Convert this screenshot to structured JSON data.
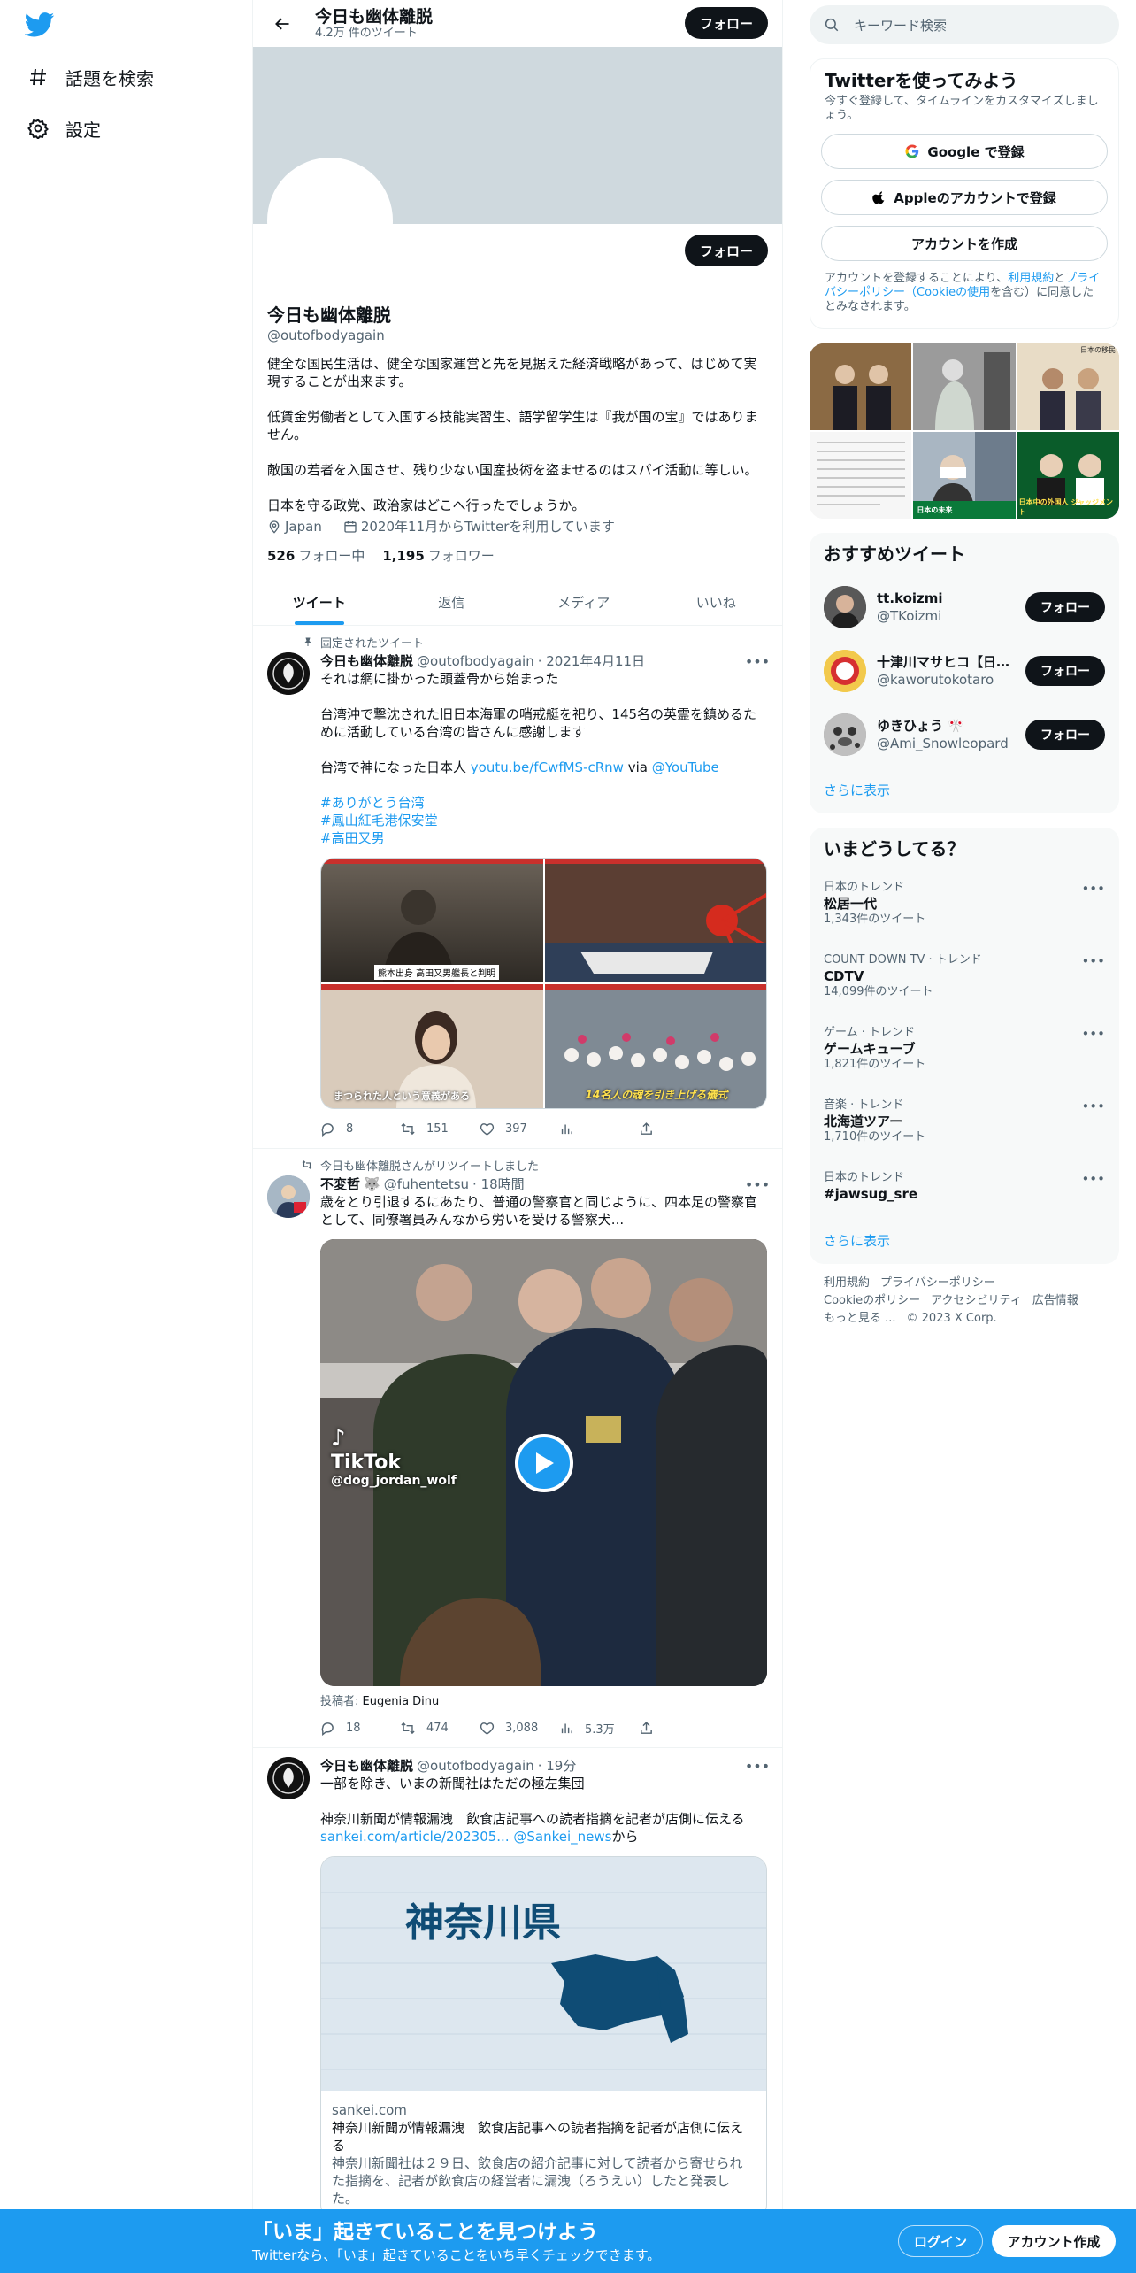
{
  "nav": {
    "logo": "twitter-bird",
    "items": [
      {
        "label": "話題を検索",
        "icon": "hashtag-icon"
      },
      {
        "label": "設定",
        "icon": "gear-icon"
      }
    ]
  },
  "header": {
    "title": "今日も幽体離脱",
    "subtitle": "4.2万 件のツイート",
    "follow_label": "フォロー"
  },
  "profile": {
    "name": "今日も幽体離脱",
    "handle": "@outofbodyagain",
    "follow_label": "フォロー",
    "bio": [
      "健全な国民生活は、健全な国家運営と先を見据えた経済戦略があって、はじめて実現することが出来ます。",
      "低賃金労働者として入国する技能実習生、語学留学生は『我が国の宝』ではありません。",
      "敵国の若者を入国させ、残り少ない国産技術を盗ませるのはスパイ活動に等しい。",
      "日本を守る政党、政治家はどこへ行ったでしょうか。"
    ],
    "location": "Japan",
    "joined": "2020年11月からTwitterを利用しています",
    "following_count": "526",
    "following_label": "フォロー中",
    "followers_count": "1,195",
    "followers_label": "フォロワー"
  },
  "tabs": [
    "ツイート",
    "返信",
    "メディア",
    "いいね"
  ],
  "tweets": [
    {
      "context": "固定されたツイート",
      "name": "今日も幽体離脱",
      "handle": "@outofbodyagain",
      "time": "· 2021年4月11日",
      "line1": "それは網に掛かった頭蓋骨から始まった",
      "line2": "台湾沖で撃沈された旧日本海軍の哨戒艇を祀り、145名の英霊を鎮めるために活動している台湾の皆さんに感謝します",
      "line3_prefix": "台湾で神になった日本人 ",
      "link": "youtu.be/fCwfMS-cRnw",
      "via": " via ",
      "mention": "@YouTube",
      "hashtags": [
        "#ありがとう台湾",
        "#鳳山紅毛港保安堂",
        "#高田又男"
      ],
      "media_captions": [
        "熊本出身 高田又男艦長と判明",
        "まつられた人という意義がある",
        "14名人の魂を引き上げる儀式"
      ],
      "replies": "8",
      "retweets": "151",
      "likes": "397"
    },
    {
      "context": "今日も幽体離脱さんがリツイートしました",
      "name": "不変哲",
      "emoji": "🐺",
      "handle": "@fuhentetsu",
      "time": "· 18時間",
      "text": "歳をとり引退するにあたり、普通の警察官と同じように、四本足の警察官として、同僚署員みんなから労いを受ける警察犬...",
      "video_brand": "TikTok",
      "video_user": "@dog_jordan_wolf",
      "poster_label": "投稿者: ",
      "poster_name": "Eugenia Dinu",
      "replies": "18",
      "retweets": "474",
      "likes": "3,088",
      "views": "5.3万"
    },
    {
      "name": "今日も幽体離脱",
      "handle": "@outofbodyagain",
      "time": "· 19分",
      "line1": "一部を除き、いまの新聞社はただの極左集団",
      "line2": "神奈川新聞が情報漏洩　飲食店記事への読者指摘を記者が店側に伝える",
      "link": "sankei.com/article/202305...",
      "mention": "@Sankei_news",
      "suffix": "から",
      "card_map_label": "神奈川県",
      "card_domain": "sankei.com",
      "card_title": "神奈川新聞が情報漏洩　飲食店記事への読者指摘を記者が店側に伝える",
      "card_desc": "神奈川新聞社は２９日、飲食店の紹介記事に対して読者から寄せられた指摘を、記者が飲食店の経営者に漏洩（ろうえい）したと発表した。"
    }
  ],
  "search": {
    "placeholder": "キーワード検索"
  },
  "signup": {
    "title": "Twitterを使ってみよう",
    "desc": "今すぐ登録して、タイムラインをカスタマイズしましょう。",
    "google": "Google で登録",
    "apple": "Appleのアカウントで登録",
    "create": "アカウントを作成",
    "terms_1": "アカウントを登録することにより、",
    "terms_link1": "利用規約",
    "terms_2": "と",
    "terms_link2": "プライバシーポリシー",
    "terms_link3": "（Cookieの使用",
    "terms_3": "を含む）に同意したとみなされます。"
  },
  "photo_captions": [
    "日本の移民",
    "日本の未来",
    "日本中の外国人 ジャッジメント"
  ],
  "recommend": {
    "title": "おすすめツイート",
    "users": [
      {
        "name": "tt.koizmi",
        "handle": "@TKoizmi"
      },
      {
        "name": "十津川マサヒコ【日…",
        "handle": "@kaworutokotaro"
      },
      {
        "name": "ゆきひょう 🎌",
        "handle": "@Ami_Snowleopard"
      }
    ],
    "follow_label": "フォロー",
    "more": "さらに表示"
  },
  "trends": {
    "title": "いまどうしてる？",
    "items": [
      {
        "category": "日本のトレンド",
        "name": "松居一代",
        "count": "1,343件のツイート"
      },
      {
        "category": "COUNT DOWN TV · トレンド",
        "name": "CDTV",
        "count": "14,099件のツイート"
      },
      {
        "category": "ゲーム · トレンド",
        "name": "ゲームキューブ",
        "count": "1,821件のツイート"
      },
      {
        "category": "音楽 · トレンド",
        "name": "北海道ツアー",
        "count": "1,710件のツイート"
      },
      {
        "category": "日本のトレンド",
        "name": "#jawsug_sre",
        "count": ""
      }
    ],
    "more": "さらに表示"
  },
  "footer": {
    "links": [
      "利用規約",
      "プライバシーポリシー",
      "Cookieのポリシー",
      "アクセシビリティ",
      "広告情報",
      "もっと見る ...",
      "© 2023 X Corp."
    ]
  },
  "bottom_bar": {
    "title": "「いま」起きていることを見つけよう",
    "subtitle": "Twitterなら、「いま」起きていることをいち早くチェックできます。",
    "login": "ログイン",
    "signup": "アカウント作成"
  },
  "colors": {
    "accent": "#1d9bf0",
    "text": "#0f1419",
    "muted": "#536471",
    "banner": "#cfd9de"
  }
}
